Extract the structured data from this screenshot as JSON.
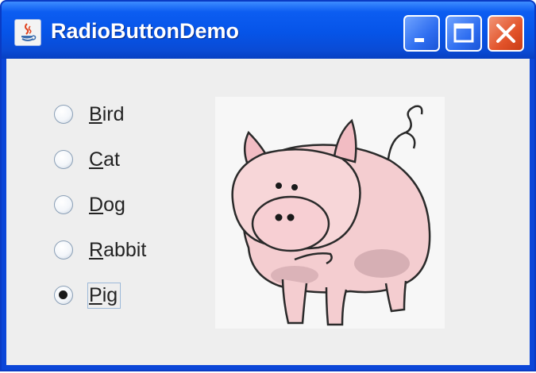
{
  "window": {
    "title": "RadioButtonDemo",
    "title_bar_color": "#0654e8",
    "close_button_color": "#e2532a"
  },
  "title_bar_buttons": [
    {
      "name": "minimize",
      "icon": "minimize-icon"
    },
    {
      "name": "maximize",
      "icon": "maximize-icon"
    },
    {
      "name": "close",
      "icon": "close-icon"
    }
  ],
  "radio_buttons": [
    {
      "mnemonic": "B",
      "rest": "ird",
      "selected": false
    },
    {
      "mnemonic": "C",
      "rest": "at",
      "selected": false
    },
    {
      "mnemonic": "D",
      "rest": "og",
      "selected": false
    },
    {
      "mnemonic": "R",
      "rest": "abbit",
      "selected": false
    },
    {
      "mnemonic": "P",
      "rest": "ig",
      "selected": true
    }
  ],
  "picture": {
    "icon": "pig-illustration"
  }
}
